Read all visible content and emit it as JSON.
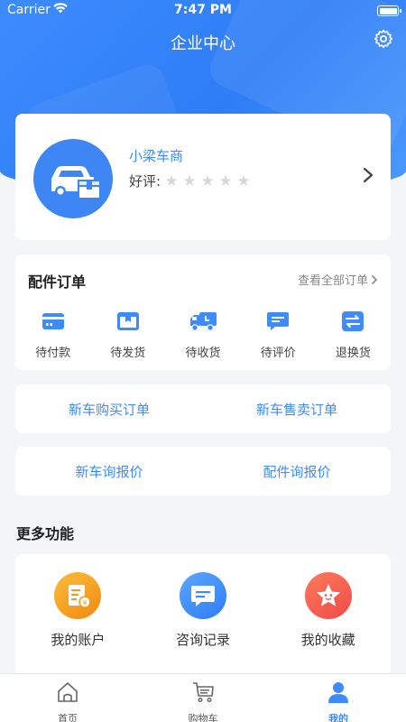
{
  "status_bar": {
    "carrier": "Carrier",
    "time": "7:47 PM"
  },
  "header": {
    "title": "企业中心"
  },
  "profile": {
    "company_name": "小梁车商",
    "rating_label": "好评:",
    "rating": 0,
    "rating_max": 5
  },
  "orders": {
    "title": "配件订单",
    "view_all": "查看全部订单",
    "items": [
      {
        "label": "待付款",
        "icon": "wallet-card-icon"
      },
      {
        "label": "待发货",
        "icon": "package-box-icon"
      },
      {
        "label": "待收货",
        "icon": "delivery-truck-icon"
      },
      {
        "label": "待评价",
        "icon": "comment-bubble-icon"
      },
      {
        "label": "退换货",
        "icon": "exchange-arrows-icon"
      }
    ]
  },
  "new_car_orders": {
    "buy": "新车购买订单",
    "sell": "新车售卖订单"
  },
  "quotes": {
    "new_car": "新车询报价",
    "parts": "配件询报价"
  },
  "more": {
    "title": "更多功能",
    "items": [
      {
        "label": "我的账户",
        "icon": "account-document-icon",
        "color": "#f7a21b"
      },
      {
        "label": "咨询记录",
        "icon": "chat-bubble-icon",
        "color": "#3d8bfd"
      },
      {
        "label": "我的收藏",
        "icon": "star-face-icon",
        "color": "#f4584a"
      }
    ]
  },
  "tabbar": {
    "items": [
      {
        "label": "首页",
        "icon": "home-icon",
        "active": false
      },
      {
        "label": "购物车",
        "icon": "cart-icon",
        "active": false
      },
      {
        "label": "我的",
        "icon": "user-icon",
        "active": true
      }
    ]
  },
  "colors": {
    "accent": "#3d8bfd",
    "star_inactive": "#d8d8d8"
  }
}
